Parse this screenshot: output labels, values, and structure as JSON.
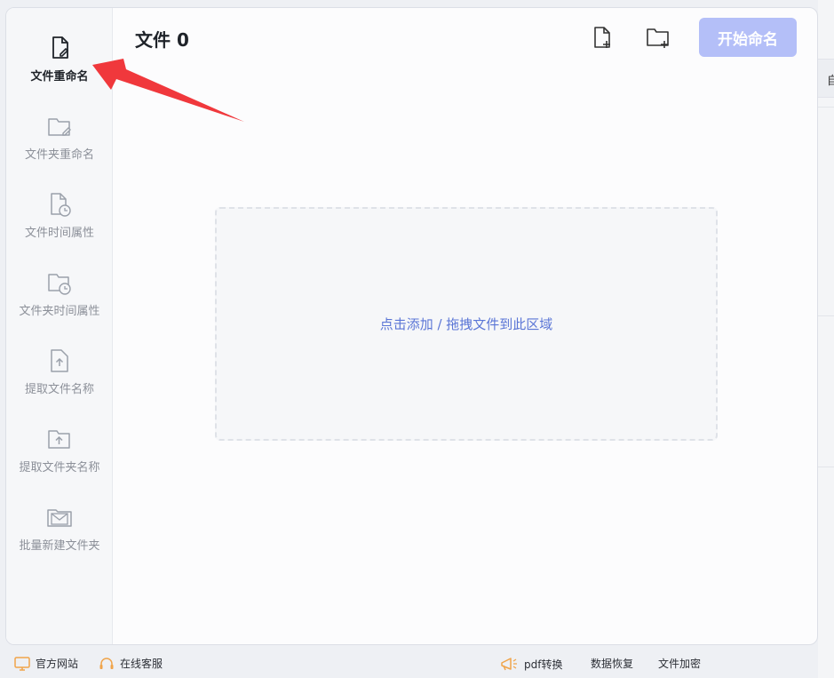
{
  "sidebar": {
    "items": [
      {
        "label": "文件重命名",
        "icon": "file-edit-icon",
        "active": true
      },
      {
        "label": "文件夹重命名",
        "icon": "folder-edit-icon"
      },
      {
        "label": "文件时间属性",
        "icon": "file-clock-icon"
      },
      {
        "label": "文件夹时间属性",
        "icon": "folder-clock-icon"
      },
      {
        "label": "提取文件名称",
        "icon": "file-upload-icon"
      },
      {
        "label": "提取文件夹名称",
        "icon": "folder-upload-icon"
      },
      {
        "label": "批量新建文件夹",
        "icon": "folder-mail-icon"
      }
    ]
  },
  "header": {
    "title": "文件 0",
    "add_file_icon": "file-plus-icon",
    "add_folder_icon": "folder-plus-icon",
    "start_label": "开始命名"
  },
  "dropzone": {
    "text": "点击添加 / 拖拽文件到此区域"
  },
  "right_panel": {
    "glyph": "自"
  },
  "footer": {
    "left": [
      {
        "label": "官方网站",
        "icon": "monitor-icon"
      },
      {
        "label": "在线客服",
        "icon": "headset-icon"
      }
    ],
    "right": [
      {
        "label": "pdf转换",
        "icon": "megaphone-icon"
      },
      {
        "label": "数据恢复"
      },
      {
        "label": "文件加密"
      }
    ]
  },
  "colors": {
    "accent": "#5b76d6",
    "start_button_disabled": "#b4bff8",
    "annotation_arrow": "#f0383c",
    "footer_icon": "#f0a44a"
  }
}
